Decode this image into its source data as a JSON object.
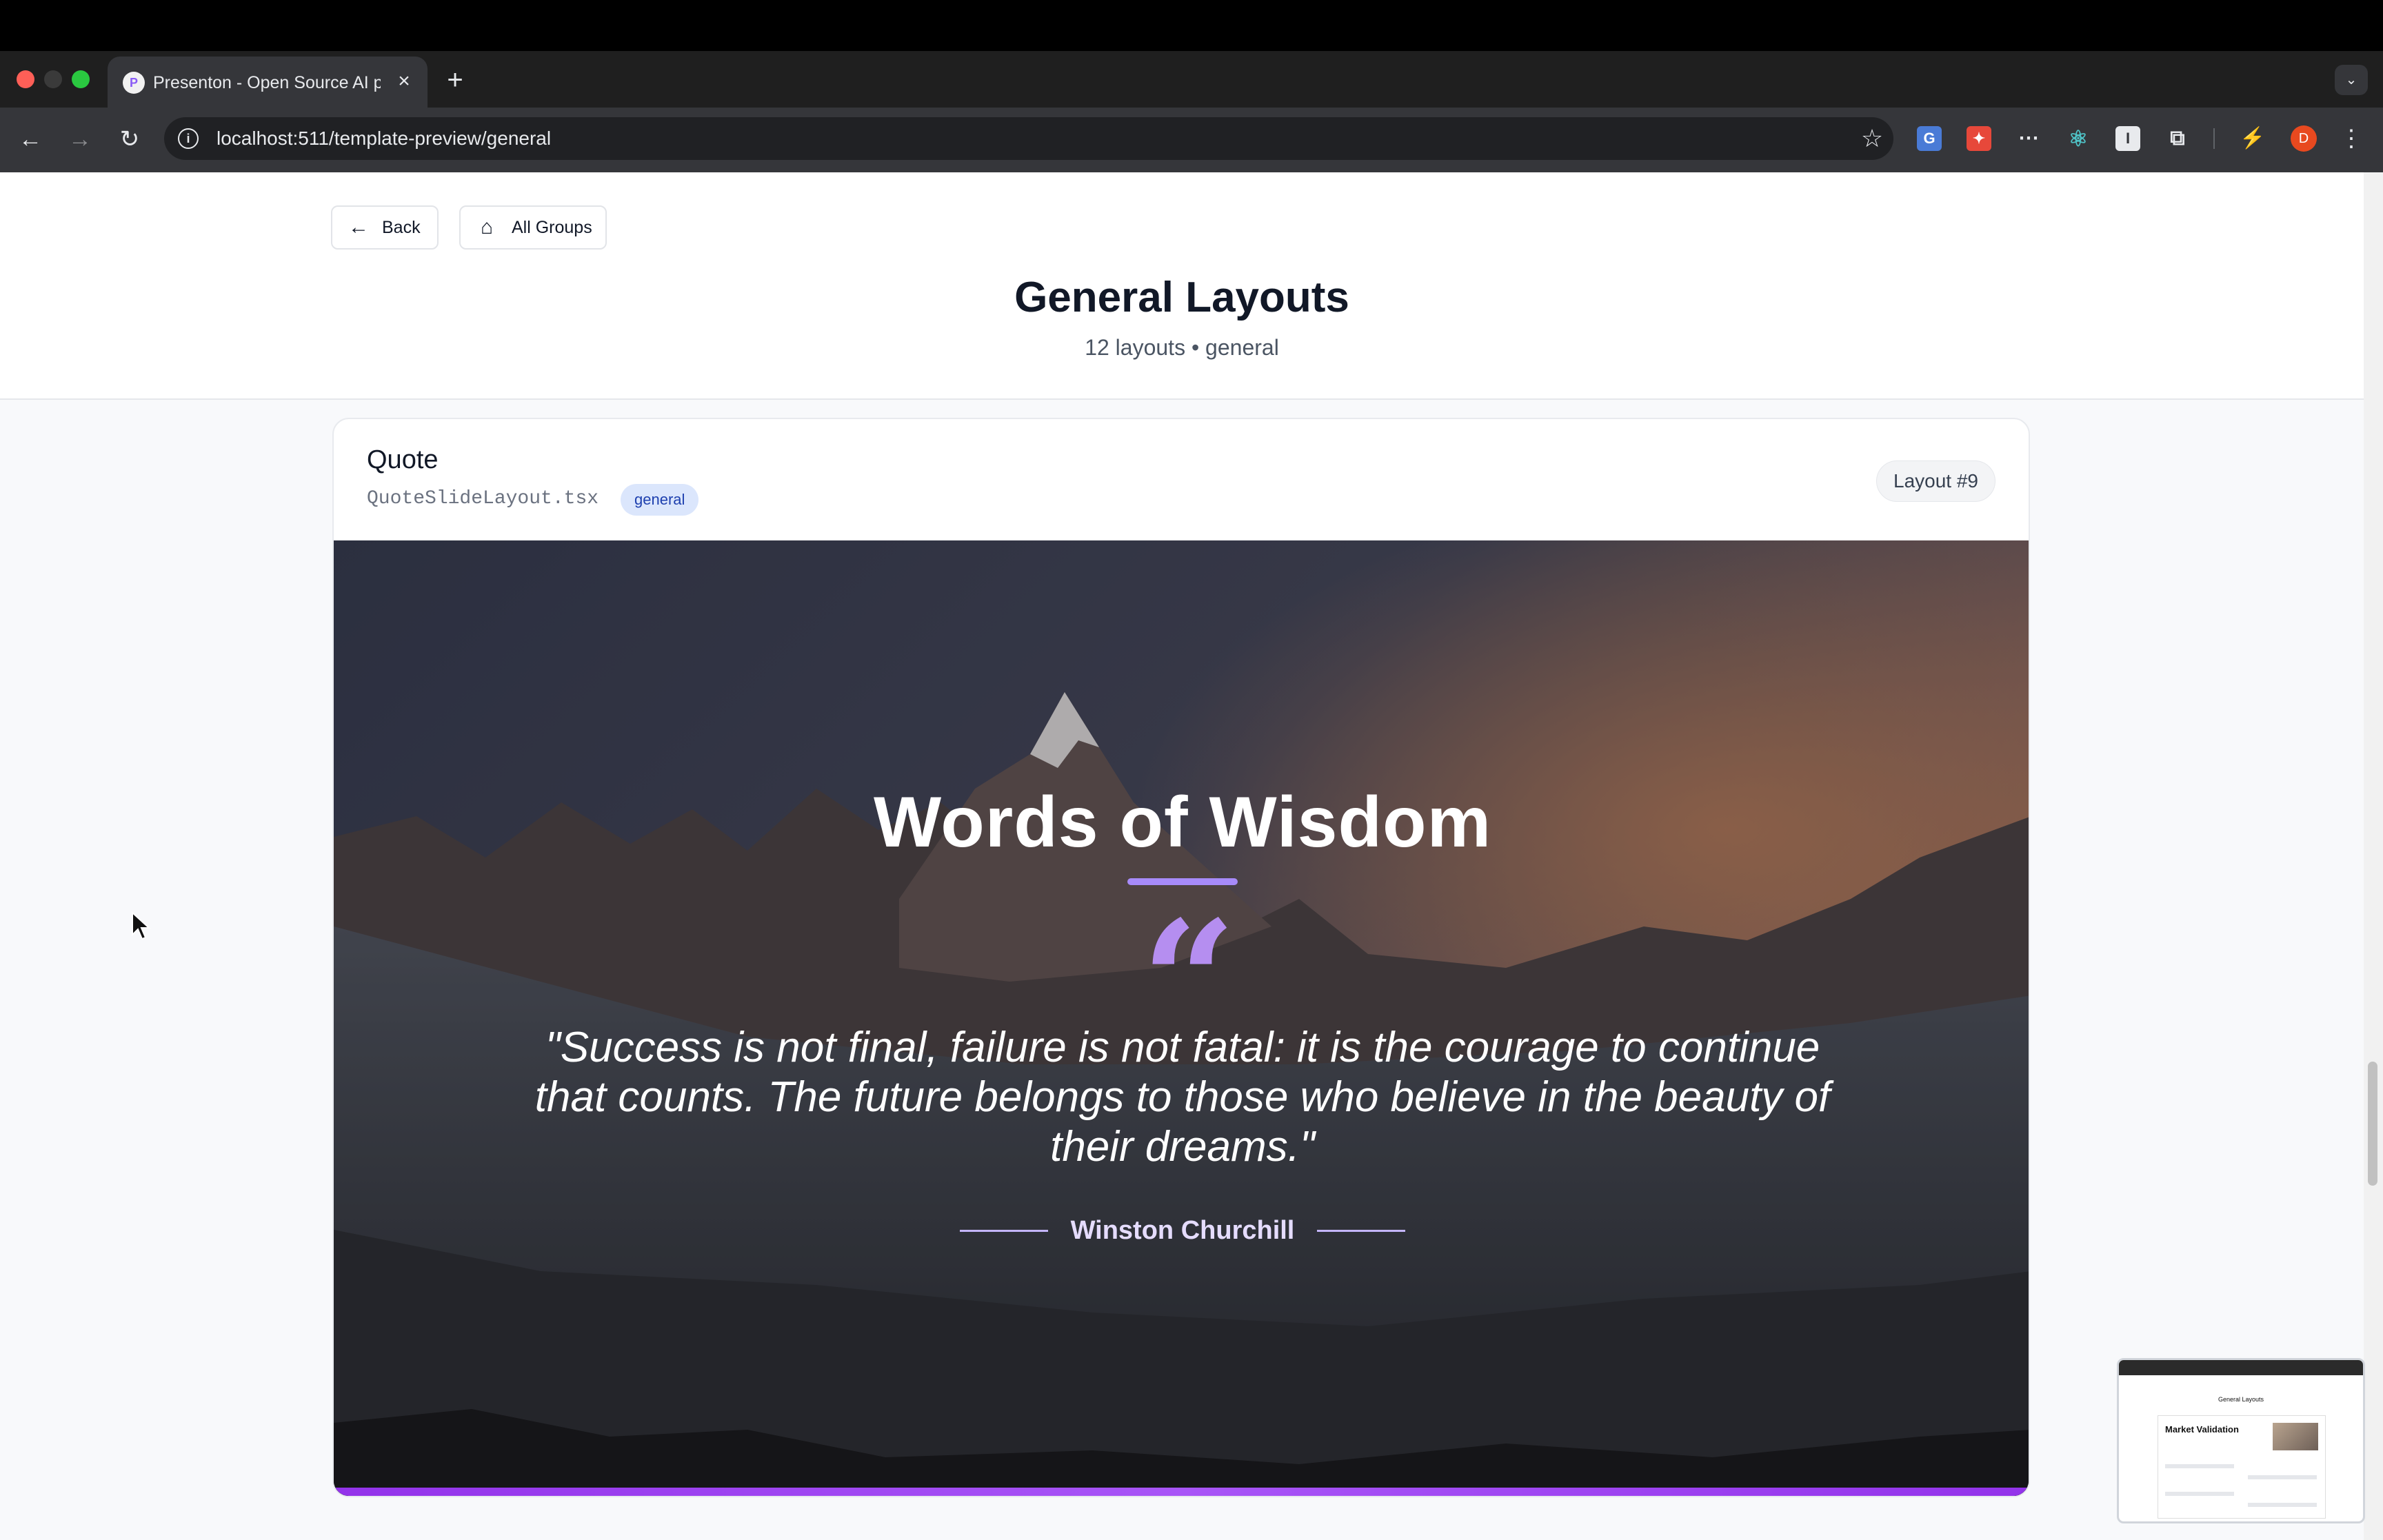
{
  "browser": {
    "tab_title": "Presenton - Open Source AI p",
    "url": "localhost:511/template-preview/general",
    "favicon_letter": "P",
    "profile_initial": "D"
  },
  "nav": {
    "back_label": "Back",
    "groups_label": "All Groups"
  },
  "header": {
    "title": "General Layouts",
    "subtitle": "12 layouts • general"
  },
  "card": {
    "title": "Quote",
    "filename": "QuoteSlideLayout.tsx",
    "badge": "general",
    "layout_number": "Layout #9"
  },
  "slide": {
    "title": "Words of Wisdom",
    "quote": "\"Success is not final, failure is not fatal: it is the courage to continue that counts. The future belongs to those who believe in the beauty of their dreams.\"",
    "author": "Winston Churchill",
    "accent_color": "#a855f7"
  },
  "thumbnail": {
    "page_title": "General Layouts",
    "slide_heading": "Market Validation"
  }
}
